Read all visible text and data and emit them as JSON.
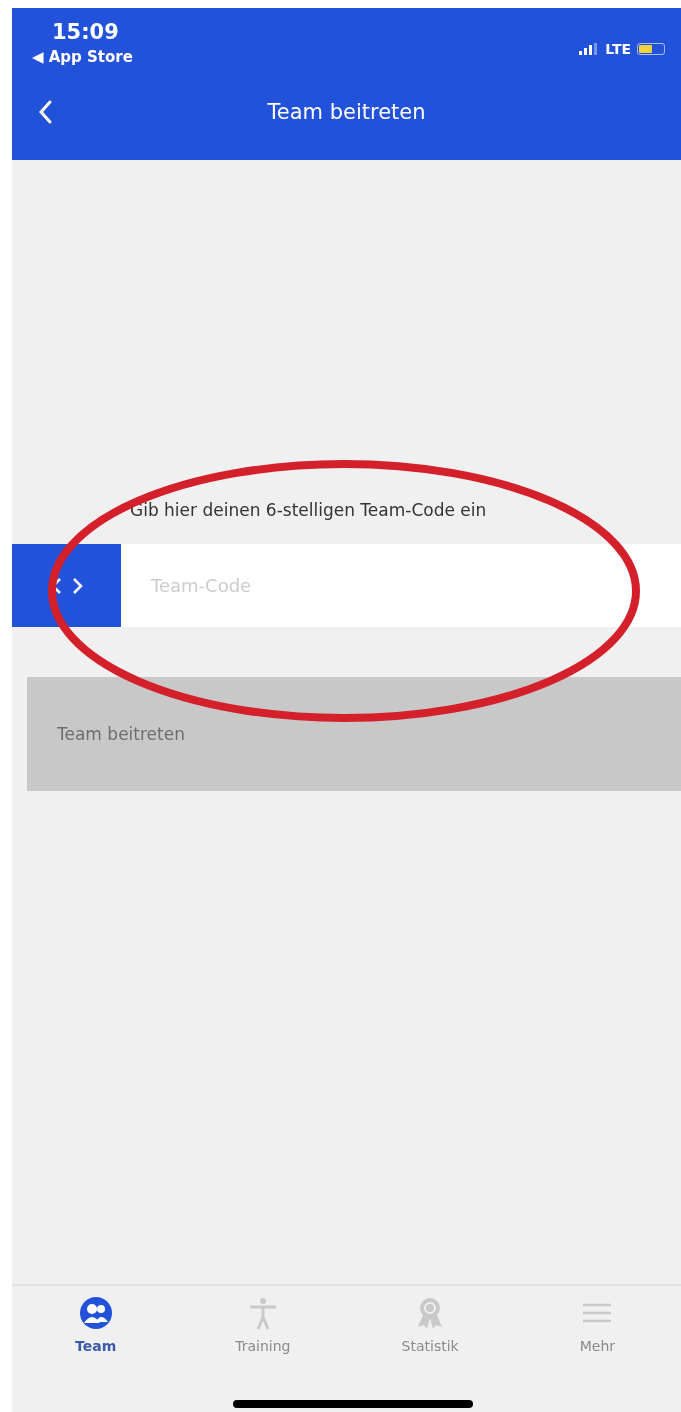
{
  "status_bar": {
    "time": "15:09",
    "back_app": "◀ App Store",
    "network": "LTE"
  },
  "nav_bar": {
    "title": "Team beitreten"
  },
  "form": {
    "hint": "Gib hier deinen 6-stelligen Team-Code ein",
    "code_field": {
      "placeholder": "Team-Code"
    },
    "submit": {
      "label": "Team beitreten",
      "disabled": true
    }
  },
  "annotation": {
    "kind": "ellipse"
  },
  "tab_bar": [
    {
      "label": "Team",
      "selected": true
    },
    {
      "label": "Training",
      "selected": false
    },
    {
      "label": "Statistik",
      "selected": false
    },
    {
      "label": "Mehr",
      "selected": false
    }
  ]
}
